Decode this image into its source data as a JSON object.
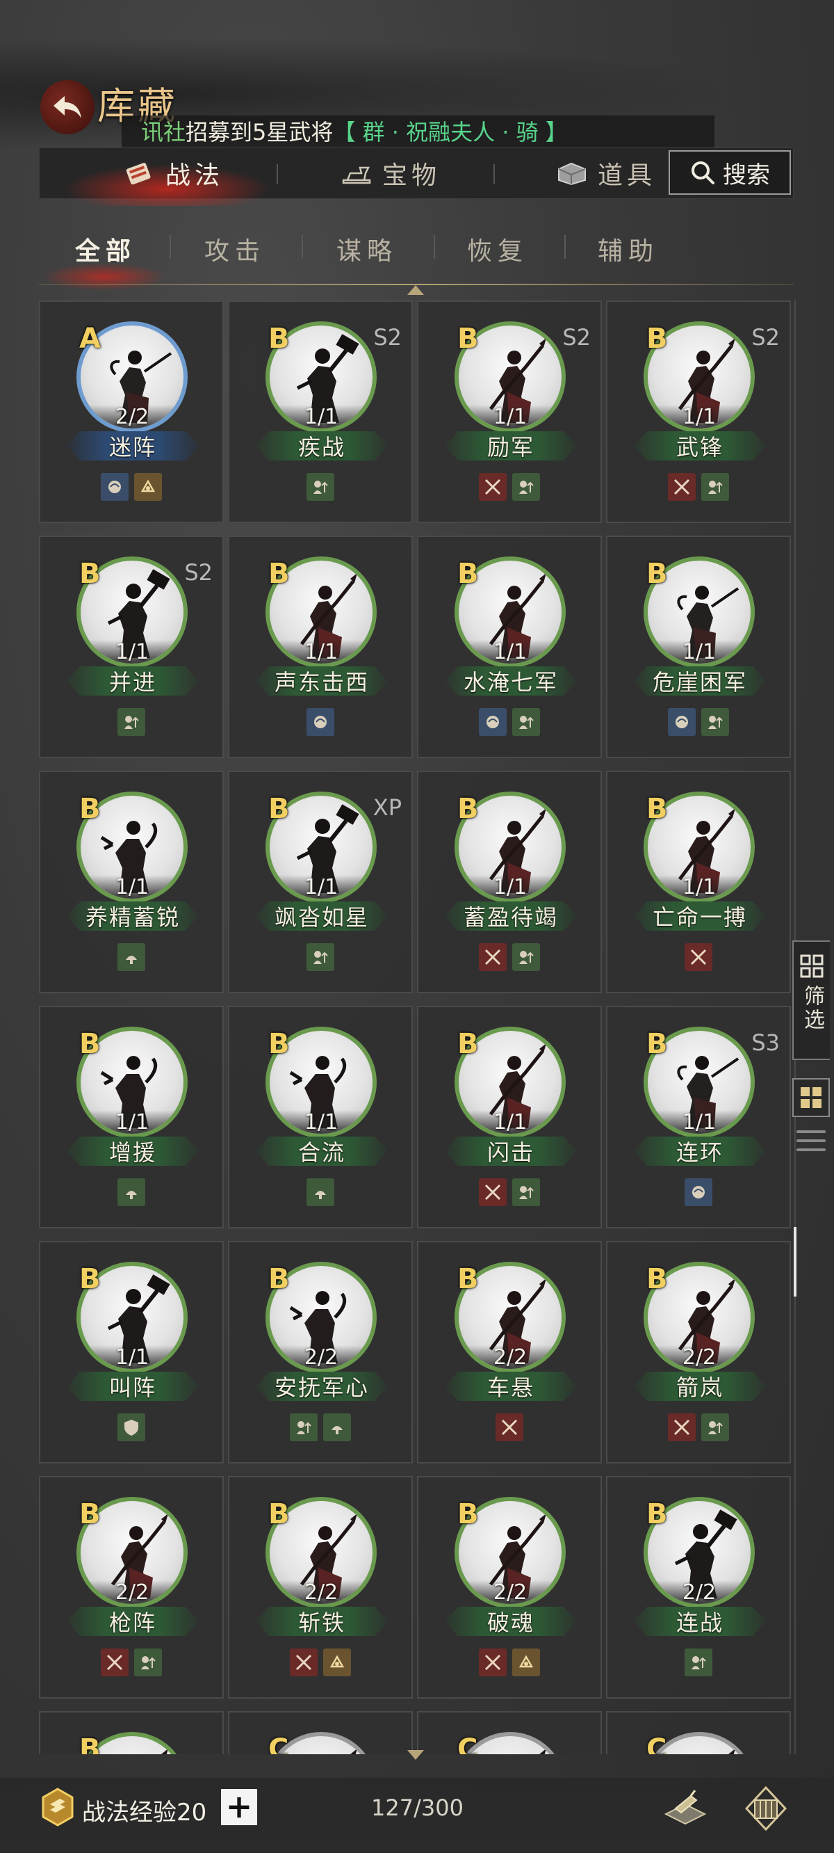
{
  "header": {
    "title": "库藏",
    "ticker": {
      "source": "讯社",
      "message": "招募到5星武将",
      "highlight": "【 群 · 祝融夫人 · 骑 】"
    }
  },
  "main_tabs": [
    {
      "label": "战法",
      "icon": "scroll-icon",
      "active": true
    },
    {
      "label": "宝物",
      "icon": "anvil-icon",
      "active": false
    },
    {
      "label": "道具",
      "icon": "chest-icon",
      "active": false
    }
  ],
  "search": {
    "label": "搜索"
  },
  "sub_tabs": [
    {
      "label": "全部",
      "active": true
    },
    {
      "label": "攻击",
      "active": false
    },
    {
      "label": "谋略",
      "active": false
    },
    {
      "label": "恢复",
      "active": false
    },
    {
      "label": "辅助",
      "active": false
    }
  ],
  "cards": [
    {
      "grade": "A",
      "season": "",
      "count": "2/2",
      "name": "迷阵",
      "tier": "blue",
      "tags": [
        "int",
        "spd"
      ],
      "pose": "sword"
    },
    {
      "grade": "B",
      "season": "S2",
      "count": "1/1",
      "name": "疾战",
      "tier": "green",
      "tags": [
        "aux"
      ],
      "pose": "hammer"
    },
    {
      "grade": "B",
      "season": "S2",
      "count": "1/1",
      "name": "励军",
      "tier": "green",
      "tags": [
        "atk",
        "aux"
      ],
      "pose": "spear"
    },
    {
      "grade": "B",
      "season": "S2",
      "count": "1/1",
      "name": "武锋",
      "tier": "green",
      "tags": [
        "atk",
        "aux"
      ],
      "pose": "spear"
    },
    {
      "grade": "B",
      "season": "S2",
      "count": "1/1",
      "name": "并进",
      "tier": "green",
      "tags": [
        "aux"
      ],
      "pose": "hammer"
    },
    {
      "grade": "B",
      "season": "",
      "count": "1/1",
      "name": "声东击西",
      "tier": "green",
      "tags": [
        "int"
      ],
      "pose": "spear"
    },
    {
      "grade": "B",
      "season": "",
      "count": "1/1",
      "name": "水淹七军",
      "tier": "green",
      "tags": [
        "int",
        "aux"
      ],
      "pose": "spear"
    },
    {
      "grade": "B",
      "season": "",
      "count": "1/1",
      "name": "危崖困军",
      "tier": "green",
      "tags": [
        "int",
        "aux"
      ],
      "pose": "sword"
    },
    {
      "grade": "B",
      "season": "",
      "count": "1/1",
      "name": "养精蓄锐",
      "tier": "green",
      "tags": [
        "heal"
      ],
      "pose": "fan"
    },
    {
      "grade": "B",
      "season": "XP",
      "count": "1/1",
      "name": "飒沓如星",
      "tier": "green",
      "tags": [
        "aux"
      ],
      "pose": "hammer"
    },
    {
      "grade": "B",
      "season": "",
      "count": "1/1",
      "name": "蓄盈待竭",
      "tier": "green",
      "tags": [
        "atk",
        "aux"
      ],
      "pose": "spear"
    },
    {
      "grade": "B",
      "season": "",
      "count": "1/1",
      "name": "亡命一搏",
      "tier": "green",
      "tags": [
        "atk"
      ],
      "pose": "spear"
    },
    {
      "grade": "B",
      "season": "",
      "count": "1/1",
      "name": "增援",
      "tier": "green",
      "tags": [
        "heal"
      ],
      "pose": "fan"
    },
    {
      "grade": "B",
      "season": "",
      "count": "1/1",
      "name": "合流",
      "tier": "green",
      "tags": [
        "heal"
      ],
      "pose": "fan"
    },
    {
      "grade": "B",
      "season": "",
      "count": "1/1",
      "name": "闪击",
      "tier": "green",
      "tags": [
        "atk",
        "aux"
      ],
      "pose": "spear"
    },
    {
      "grade": "B",
      "season": "S3",
      "count": "1/1",
      "name": "连环",
      "tier": "green",
      "tags": [
        "int"
      ],
      "pose": "sword"
    },
    {
      "grade": "B",
      "season": "",
      "count": "1/1",
      "name": "叫阵",
      "tier": "green",
      "tags": [
        "def"
      ],
      "pose": "hammer"
    },
    {
      "grade": "B",
      "season": "",
      "count": "2/2",
      "name": "安抚军心",
      "tier": "green",
      "tags": [
        "aux",
        "heal"
      ],
      "pose": "fan"
    },
    {
      "grade": "B",
      "season": "",
      "count": "2/2",
      "name": "车悬",
      "tier": "green",
      "tags": [
        "atk"
      ],
      "pose": "spear"
    },
    {
      "grade": "B",
      "season": "",
      "count": "2/2",
      "name": "箭岚",
      "tier": "green",
      "tags": [
        "atk",
        "aux"
      ],
      "pose": "spear"
    },
    {
      "grade": "B",
      "season": "",
      "count": "2/2",
      "name": "枪阵",
      "tier": "green",
      "tags": [
        "atk",
        "aux"
      ],
      "pose": "spear"
    },
    {
      "grade": "B",
      "season": "",
      "count": "2/2",
      "name": "斩铁",
      "tier": "green",
      "tags": [
        "atk",
        "spd"
      ],
      "pose": "spear"
    },
    {
      "grade": "B",
      "season": "",
      "count": "2/2",
      "name": "破魂",
      "tier": "green",
      "tags": [
        "atk",
        "spd"
      ],
      "pose": "spear"
    },
    {
      "grade": "B",
      "season": "",
      "count": "2/2",
      "name": "连战",
      "tier": "green",
      "tags": [
        "aux"
      ],
      "pose": "hammer"
    },
    {
      "grade": "B",
      "season": "",
      "count": "",
      "name": "",
      "tier": "green",
      "tags": [],
      "pose": "spear"
    },
    {
      "grade": "C",
      "season": "",
      "count": "",
      "name": "",
      "tier": "grey",
      "tags": [],
      "pose": "spear"
    },
    {
      "grade": "C",
      "season": "",
      "count": "",
      "name": "",
      "tier": "grey",
      "tags": [],
      "pose": "spear"
    },
    {
      "grade": "C",
      "season": "",
      "count": "",
      "name": "",
      "tier": "grey",
      "tags": [],
      "pose": "spear"
    }
  ],
  "side": {
    "filter_label": "筛选"
  },
  "bottom": {
    "exp_label": "战法经验20",
    "plus_label": "+",
    "capacity": "127/300"
  },
  "colors": {
    "grade_gold": "#f1cf61",
    "tier_green": "#6a9a4e",
    "tier_blue": "#6f9ccf",
    "ticker_green": "#58d48a"
  }
}
